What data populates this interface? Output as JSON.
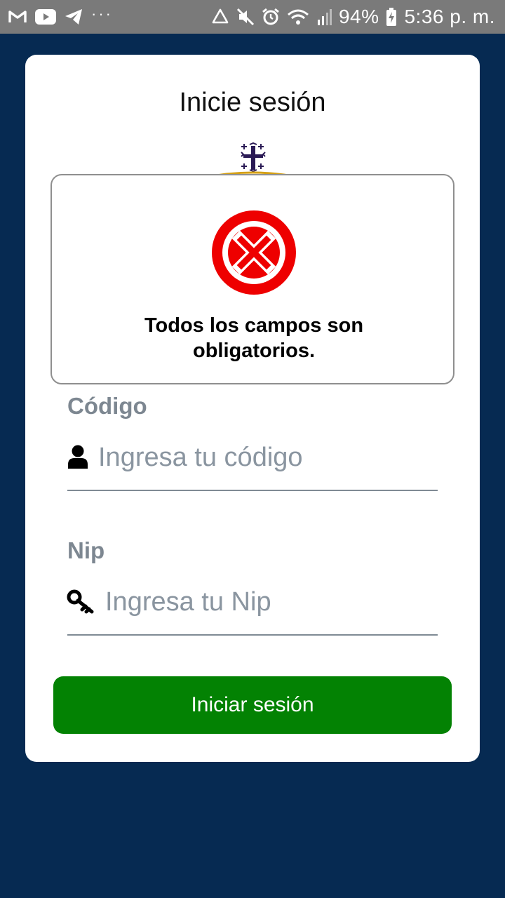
{
  "status_bar": {
    "left_icons": [
      "gmail-icon",
      "youtube-icon",
      "telegram-icon"
    ],
    "more": "···",
    "right_icons": [
      "recycle-icon",
      "mute-icon",
      "alarm-icon",
      "wifi-icon",
      "signal-icon",
      "battery-charging-icon"
    ],
    "battery": "94%",
    "time": "5:36 p. m."
  },
  "login": {
    "title": "Inicie sesión",
    "logo": "cross-emblem-icon",
    "code_label": "Código",
    "code_placeholder": "Ingresa tu código",
    "code_icon": "user-icon",
    "nip_label": "Nip",
    "nip_placeholder": "Ingresa tu Nip",
    "nip_icon": "key-icon",
    "submit_label": "Iniciar sesión"
  },
  "alert": {
    "icon": "error-x-icon",
    "message": "Todos los campos son obligatorios."
  },
  "colors": {
    "background": "#062a52",
    "status_bar": "#7a7a7a",
    "button": "#038203",
    "error": "#ee0000",
    "label": "#7d8791"
  }
}
